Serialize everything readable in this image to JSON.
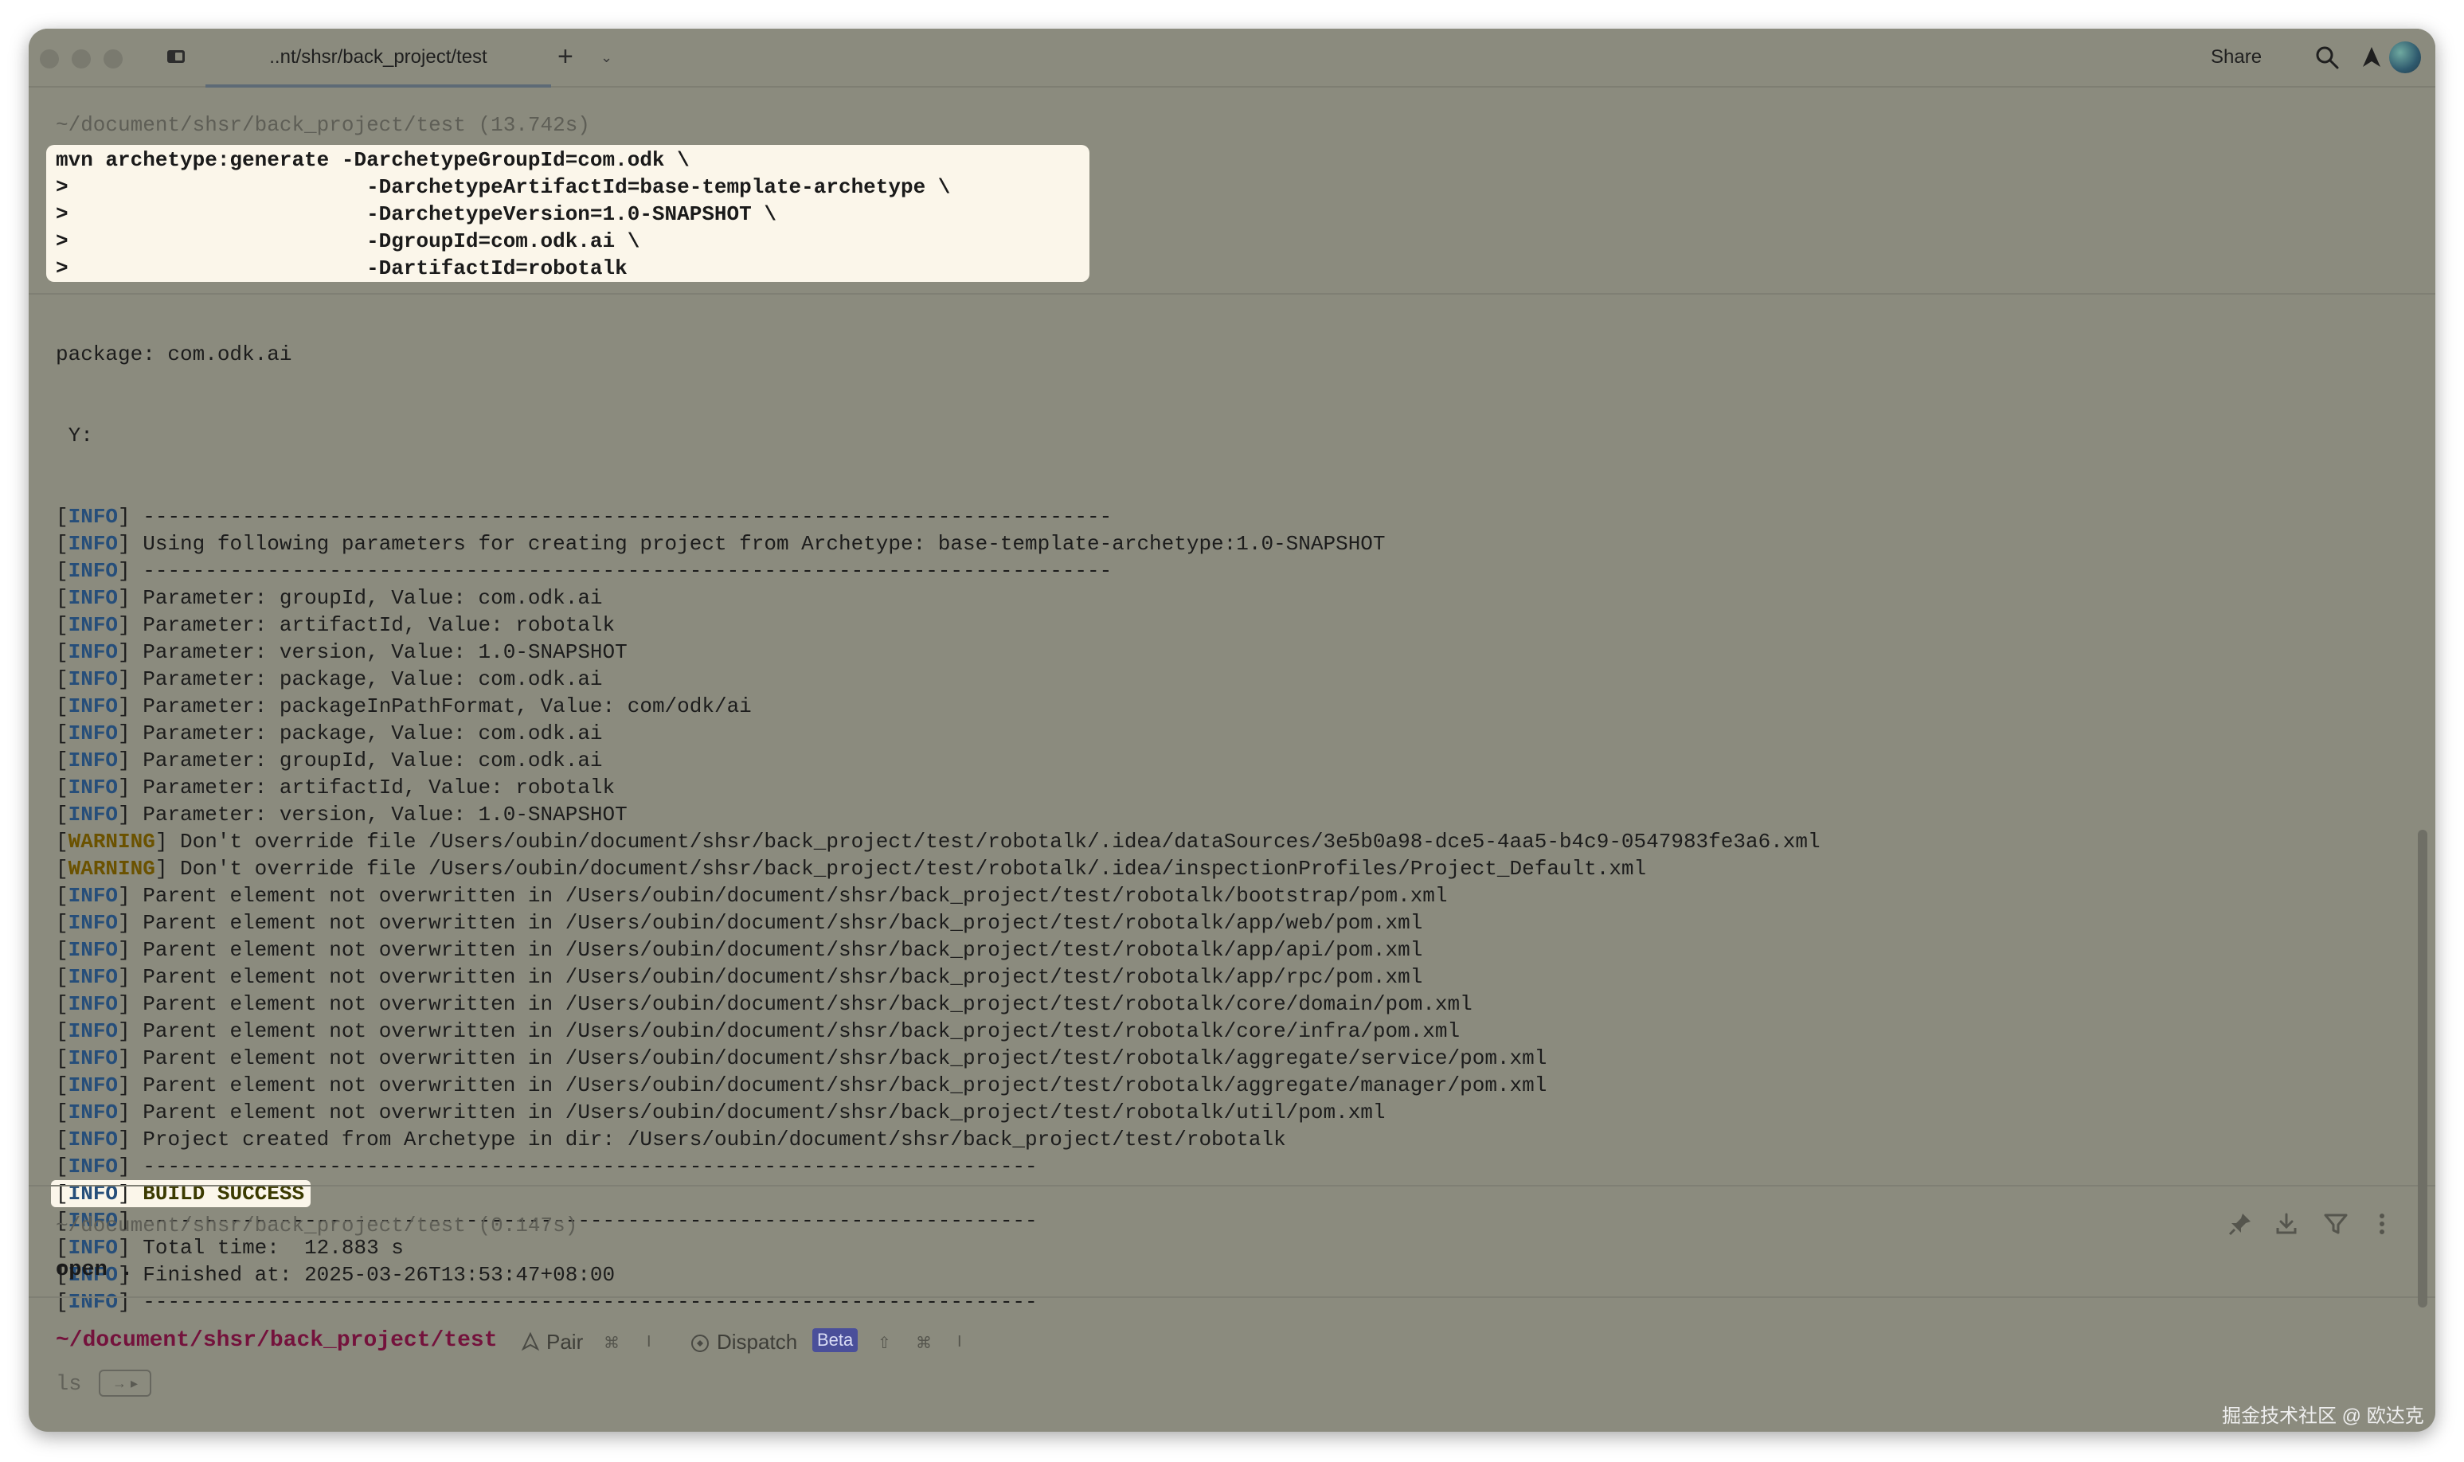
{
  "titlebar": {
    "tab_title": "..nt/shsr/back_project/test",
    "new_tab_symbol": "+",
    "new_tab_menu_symbol": "⌄",
    "share_label": "Share"
  },
  "blocks": [
    {
      "path_line": "~/document/shsr/back_project/test (13.742s)",
      "command_lines": [
        "mvn archetype:generate -DarchetypeGroupId=com.odk \\",
        ">                        -DarchetypeArtifactId=base-template-archetype \\",
        ">                        -DarchetypeVersion=1.0-SNAPSHOT \\",
        ">                        -DgroupId=com.odk.ai \\",
        ">                        -DartifactId=robotalk"
      ]
    },
    {
      "path_line": "~/document/shsr/back_project/test (0.147s)",
      "command": "open ."
    }
  ],
  "output_pre": [
    "package: com.odk.ai",
    " Y:"
  ],
  "output_log": [
    {
      "tag": "INFO",
      "text": " ------------------------------------------------------------------------------"
    },
    {
      "tag": "INFO",
      "text": " Using following parameters for creating project from Archetype: base-template-archetype:1.0-SNAPSHOT"
    },
    {
      "tag": "INFO",
      "text": " ------------------------------------------------------------------------------"
    },
    {
      "tag": "INFO",
      "text": " Parameter: groupId, Value: com.odk.ai"
    },
    {
      "tag": "INFO",
      "text": " Parameter: artifactId, Value: robotalk"
    },
    {
      "tag": "INFO",
      "text": " Parameter: version, Value: 1.0-SNAPSHOT"
    },
    {
      "tag": "INFO",
      "text": " Parameter: package, Value: com.odk.ai"
    },
    {
      "tag": "INFO",
      "text": " Parameter: packageInPathFormat, Value: com/odk/ai"
    },
    {
      "tag": "INFO",
      "text": " Parameter: package, Value: com.odk.ai"
    },
    {
      "tag": "INFO",
      "text": " Parameter: groupId, Value: com.odk.ai"
    },
    {
      "tag": "INFO",
      "text": " Parameter: artifactId, Value: robotalk"
    },
    {
      "tag": "INFO",
      "text": " Parameter: version, Value: 1.0-SNAPSHOT"
    },
    {
      "tag": "WARNING",
      "text": " Don't override file /Users/oubin/document/shsr/back_project/test/robotalk/.idea/dataSources/3e5b0a98-dce5-4aa5-b4c9-0547983fe3a6.xml"
    },
    {
      "tag": "WARNING",
      "text": " Don't override file /Users/oubin/document/shsr/back_project/test/robotalk/.idea/inspectionProfiles/Project_Default.xml"
    },
    {
      "tag": "INFO",
      "text": " Parent element not overwritten in /Users/oubin/document/shsr/back_project/test/robotalk/bootstrap/pom.xml"
    },
    {
      "tag": "INFO",
      "text": " Parent element not overwritten in /Users/oubin/document/shsr/back_project/test/robotalk/app/web/pom.xml"
    },
    {
      "tag": "INFO",
      "text": " Parent element not overwritten in /Users/oubin/document/shsr/back_project/test/robotalk/app/api/pom.xml"
    },
    {
      "tag": "INFO",
      "text": " Parent element not overwritten in /Users/oubin/document/shsr/back_project/test/robotalk/app/rpc/pom.xml"
    },
    {
      "tag": "INFO",
      "text": " Parent element not overwritten in /Users/oubin/document/shsr/back_project/test/robotalk/core/domain/pom.xml"
    },
    {
      "tag": "INFO",
      "text": " Parent element not overwritten in /Users/oubin/document/shsr/back_project/test/robotalk/core/infra/pom.xml"
    },
    {
      "tag": "INFO",
      "text": " Parent element not overwritten in /Users/oubin/document/shsr/back_project/test/robotalk/aggregate/service/pom.xml"
    },
    {
      "tag": "INFO",
      "text": " Parent element not overwritten in /Users/oubin/document/shsr/back_project/test/robotalk/aggregate/manager/pom.xml"
    },
    {
      "tag": "INFO",
      "text": " Parent element not overwritten in /Users/oubin/document/shsr/back_project/test/robotalk/util/pom.xml"
    },
    {
      "tag": "INFO",
      "text": " Project created from Archetype in dir: /Users/oubin/document/shsr/back_project/test/robotalk"
    },
    {
      "tag": "INFO",
      "text": " ------------------------------------------------------------------------"
    },
    {
      "tag": "INFO",
      "text": " BUILD SUCCESS",
      "highlight": true
    },
    {
      "tag": "INFO",
      "text": " ------------------------------------------------------------------------"
    },
    {
      "tag": "INFO",
      "text": " Total time:  12.883 s"
    },
    {
      "tag": "INFO",
      "text": " Finished at: 2025-03-26T13:53:47+08:00"
    },
    {
      "tag": "INFO",
      "text": " ------------------------------------------------------------------------"
    }
  ],
  "prompt": {
    "path": "~/document/shsr/back_project/test",
    "pair_label": "Pair",
    "pair_shortcut": "⌘",
    "pair_shortcut_key": "I",
    "dispatch_label": "Dispatch",
    "beta_badge": "Beta",
    "dispatch_shortcut_shift": "⇧",
    "dispatch_shortcut_cmd": "⌘",
    "dispatch_shortcut_key": "I",
    "input_hint": "ls",
    "input_hint_key": "→ ▸"
  },
  "watermark": "掘金技术社区 @ 欧达克",
  "colors": {
    "window_bg": "#8b8b7e",
    "info_tag": "#264e7a",
    "warning_tag": "#6b5200",
    "highlight_bg": "#fbf6ea",
    "prompt_path": "#74123c"
  },
  "icons": [
    "sidebar-toggle-icon",
    "search-icon",
    "warp-agent-icon",
    "avatar",
    "pin-icon",
    "download-icon",
    "filter-icon",
    "more-vertical-icon"
  ]
}
